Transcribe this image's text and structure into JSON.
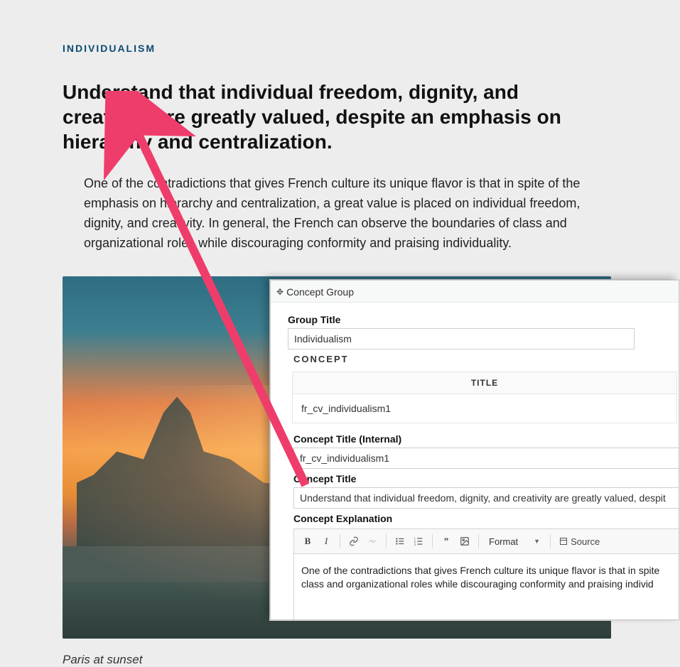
{
  "article": {
    "eyebrow": "INDIVIDUALISM",
    "title": "Understand that individual freedom, dignity, and creativity are greatly valued, despite an emphasis on hierarchy and centralization.",
    "body": "One of the contradictions that gives French culture its unique flavor is that in spite of the emphasis on hierarchy and centralization, a great value is placed on individual freedom, dignity, and creativity. In general, the French can observe the boundaries of class and organizational roles while discouraging conformity and praising individuality.",
    "caption": "Paris at sunset"
  },
  "panel": {
    "header": "Concept Group",
    "labels": {
      "group_title": "Group Title",
      "concept": "CONCEPT",
      "title_col": "TITLE",
      "concept_title_internal": "Concept Title (Internal)",
      "concept_title": "Concept Title",
      "concept_explanation": "Concept Explanation"
    },
    "fields": {
      "group_title": "Individualism",
      "title_cell": "fr_cv_individualism1",
      "concept_title_internal": "fr_cv_individualism1",
      "concept_title": "Understand that individual freedom, dignity, and creativity are greatly valued, despit",
      "explanation": "One of the contradictions that gives French culture its unique flavor is that in spite class and organizational roles while discouraging conformity and praising individ"
    },
    "toolbar": {
      "bold": "B",
      "italic": "I",
      "link": "🔗",
      "unlink": "⛓",
      "ul": "•≡",
      "ol": "1≡",
      "quote": "❝❞",
      "image": "🖼",
      "format": "Format",
      "caret": "▾",
      "source_icon": "◧",
      "source": "Source"
    }
  }
}
